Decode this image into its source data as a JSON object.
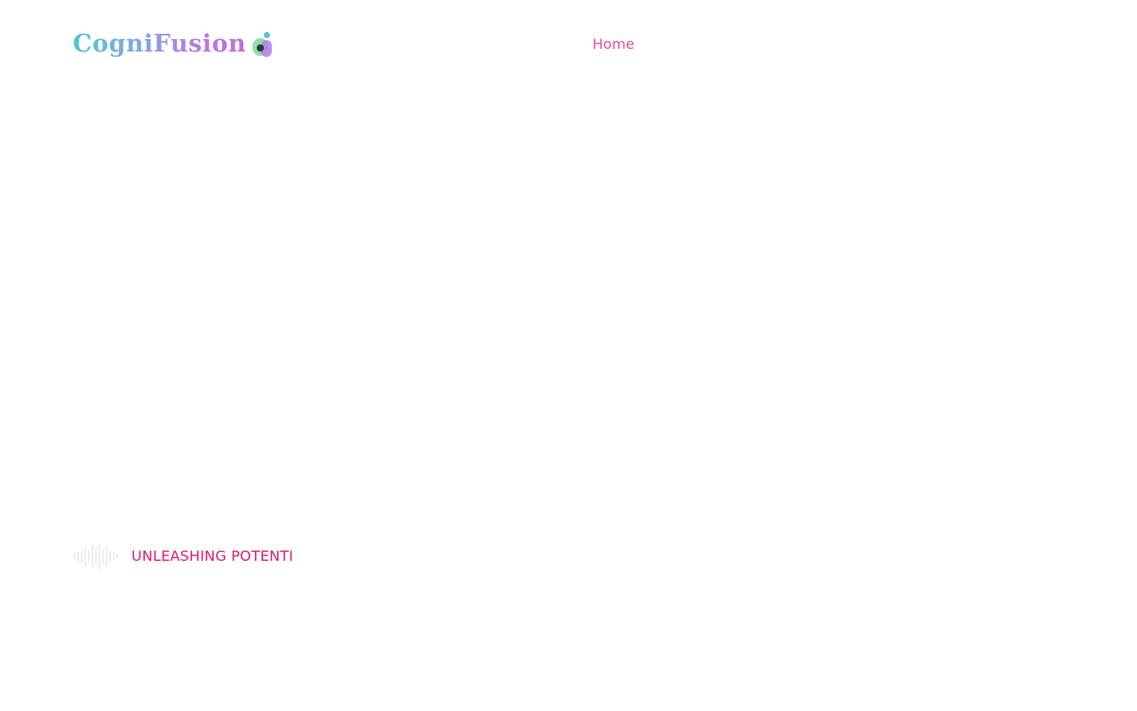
{
  "header": {
    "logo_text": "CogniFusion",
    "nav": [
      {
        "label": "Home"
      }
    ]
  },
  "hero": {
    "tagline": "UNLEASHING POTENTI"
  },
  "colors": {
    "accent": "#ec4a8e",
    "tagline": "#e0186c",
    "logo_gradient_start": "#4fc6d6",
    "logo_gradient_end": "#c56ae0"
  },
  "icons": {
    "logo_mark": "brain-logo-icon",
    "tagline_decoration": "sound-wave-icon"
  }
}
